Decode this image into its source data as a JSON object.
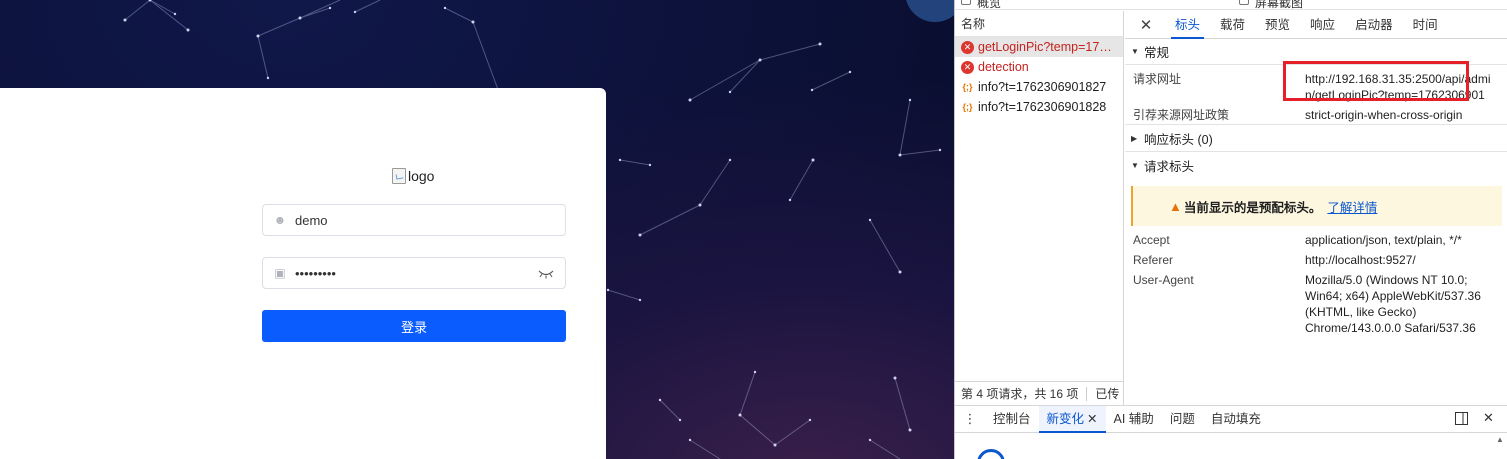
{
  "login": {
    "logo_alt": "logo",
    "username_value": "demo",
    "password_value": "•••••••••",
    "login_button": "登录"
  },
  "devtools": {
    "top_checkboxes": [
      "概览",
      "屏幕截图"
    ],
    "list": {
      "header": "名称",
      "requests": [
        {
          "name": "getLoginPic?temp=17…",
          "status": "error"
        },
        {
          "name": "detection",
          "status": "error"
        },
        {
          "name": "info?t=1762306901827",
          "status": "json"
        },
        {
          "name": "info?t=1762306901828",
          "status": "json"
        }
      ],
      "footer_count": "第 4 项请求，共 16 项",
      "footer_more": "已传"
    },
    "tabs": [
      "标头",
      "载荷",
      "预览",
      "响应",
      "启动器",
      "时间"
    ],
    "active_tab": "标头",
    "general": {
      "title": "常规",
      "rows": [
        {
          "key": "请求网址",
          "value": "http://192.168.31.35:2500/api/admin/getLoginPic?temp=1762306901"
        },
        {
          "key": "引荐来源网址政策",
          "value": "strict-origin-when-cross-origin"
        }
      ]
    },
    "response_headers": {
      "title": "响应标头 (0)"
    },
    "request_headers": {
      "title": "请求标头",
      "warning": "当前显示的是预配标头。",
      "warning_link": "了解详情",
      "rows": [
        {
          "key": "Accept",
          "value": "application/json, text/plain, */*"
        },
        {
          "key": "Referer",
          "value": "http://localhost:9527/"
        },
        {
          "key": "User-Agent",
          "value": "Mozilla/5.0 (Windows NT 10.0; Win64; x64) AppleWebKit/537.36 (KHTML, like Gecko) Chrome/143.0.0.0 Safari/537.36"
        }
      ]
    },
    "drawer": {
      "tabs": [
        "控制台",
        "新变化",
        "AI 辅助",
        "问题",
        "自动填充"
      ],
      "active": "新变化"
    },
    "colors": {
      "accent": "#0b57d0",
      "error": "#dc362e",
      "highlight_box": "#e5202a",
      "login_button": "#0b5cff"
    }
  }
}
